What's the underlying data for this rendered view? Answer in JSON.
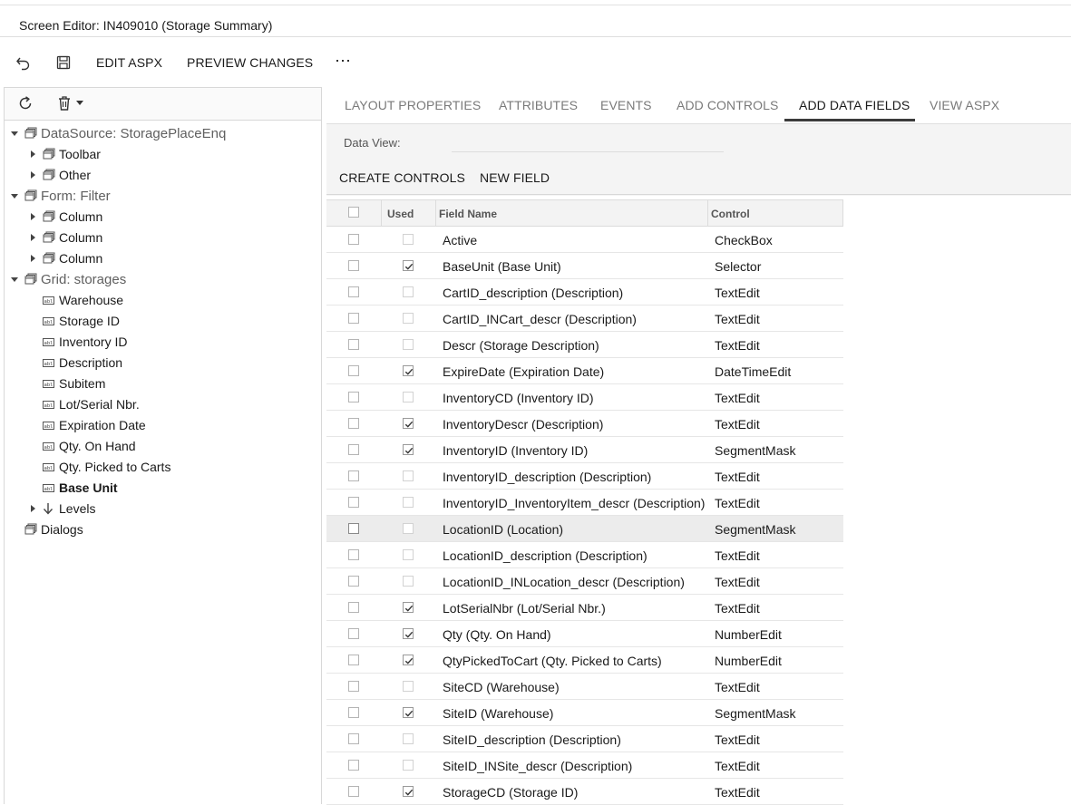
{
  "window": {
    "title": "Screen Editor: IN409010 (Storage Summary)"
  },
  "toolbar": {
    "undo_icon": "undo-icon",
    "save_icon": "save-icon",
    "edit_aspx": "EDIT ASPX",
    "preview_changes": "PREVIEW CHANGES",
    "more": "⋯"
  },
  "tree": {
    "refresh_icon": "refresh-icon",
    "delete_icon": "trash-icon",
    "nodes": [
      {
        "label": "DataSource: StoragePlaceEnq",
        "level": 0,
        "expanded": true
      },
      {
        "label": "Toolbar",
        "level": 1,
        "collapsed": true
      },
      {
        "label": "Other",
        "level": 1,
        "collapsed": true
      },
      {
        "label": "Form: Filter",
        "level": 0,
        "expanded": true
      },
      {
        "label": "Column",
        "level": 1,
        "collapsed": true
      },
      {
        "label": "Column",
        "level": 1,
        "collapsed": true
      },
      {
        "label": "Column",
        "level": 1,
        "collapsed": true
      },
      {
        "label": "Grid: storages",
        "level": 0,
        "expanded": true
      },
      {
        "label": "Warehouse",
        "level": 1,
        "field": true
      },
      {
        "label": "Storage ID",
        "level": 1,
        "field": true
      },
      {
        "label": "Inventory ID",
        "level": 1,
        "field": true
      },
      {
        "label": "Description",
        "level": 1,
        "field": true
      },
      {
        "label": "Subitem",
        "level": 1,
        "field": true
      },
      {
        "label": "Lot/Serial Nbr.",
        "level": 1,
        "field": true
      },
      {
        "label": "Expiration Date",
        "level": 1,
        "field": true
      },
      {
        "label": "Qty. On Hand",
        "level": 1,
        "field": true
      },
      {
        "label": "Qty. Picked to Carts",
        "level": 1,
        "field": true
      },
      {
        "label": "Base Unit",
        "level": 1,
        "field": true,
        "bold": true
      },
      {
        "label": "Levels",
        "level": 1,
        "collapsed": true,
        "arrow": true
      },
      {
        "label": "Dialogs",
        "level": 0
      }
    ]
  },
  "tabs": [
    {
      "label": "LAYOUT PROPERTIES",
      "active": false
    },
    {
      "label": "ATTRIBUTES",
      "active": false
    },
    {
      "label": "EVENTS",
      "active": false
    },
    {
      "label": "ADD CONTROLS",
      "active": false
    },
    {
      "label": "ADD DATA FIELDS",
      "active": true
    },
    {
      "label": "VIEW ASPX",
      "active": false
    }
  ],
  "data_view": {
    "label": "Data View:",
    "value": ""
  },
  "actions": {
    "create_controls": "CREATE CONTROLS",
    "new_field": "NEW FIELD"
  },
  "grid": {
    "headers": {
      "used": "Used",
      "field_name": "Field Name",
      "control": "Control"
    },
    "rows": [
      {
        "used": false,
        "field": "Active",
        "control": "CheckBox"
      },
      {
        "used": true,
        "field": "BaseUnit (Base Unit)",
        "control": "Selector"
      },
      {
        "used": false,
        "field": "CartID_description (Description)",
        "control": "TextEdit"
      },
      {
        "used": false,
        "field": "CartID_INCart_descr (Description)",
        "control": "TextEdit"
      },
      {
        "used": false,
        "field": "Descr (Storage Description)",
        "control": "TextEdit"
      },
      {
        "used": true,
        "field": "ExpireDate (Expiration Date)",
        "control": "DateTimeEdit"
      },
      {
        "used": false,
        "field": "InventoryCD (Inventory ID)",
        "control": "TextEdit"
      },
      {
        "used": true,
        "field": "InventoryDescr (Description)",
        "control": "TextEdit"
      },
      {
        "used": true,
        "field": "InventoryID (Inventory ID)",
        "control": "SegmentMask"
      },
      {
        "used": false,
        "field": "InventoryID_description (Description)",
        "control": "TextEdit"
      },
      {
        "used": false,
        "field": "InventoryID_InventoryItem_descr (Description)",
        "control": "TextEdit"
      },
      {
        "used": false,
        "field": "LocationID (Location)",
        "control": "SegmentMask",
        "highlighted": true
      },
      {
        "used": false,
        "field": "LocationID_description (Description)",
        "control": "TextEdit"
      },
      {
        "used": false,
        "field": "LocationID_INLocation_descr (Description)",
        "control": "TextEdit"
      },
      {
        "used": true,
        "field": "LotSerialNbr (Lot/Serial Nbr.)",
        "control": "TextEdit"
      },
      {
        "used": true,
        "field": "Qty (Qty. On Hand)",
        "control": "NumberEdit"
      },
      {
        "used": true,
        "field": "QtyPickedToCart (Qty. Picked to Carts)",
        "control": "NumberEdit"
      },
      {
        "used": false,
        "field": "SiteCD (Warehouse)",
        "control": "TextEdit"
      },
      {
        "used": true,
        "field": "SiteID (Warehouse)",
        "control": "SegmentMask"
      },
      {
        "used": false,
        "field": "SiteID_description (Description)",
        "control": "TextEdit"
      },
      {
        "used": false,
        "field": "SiteID_INSite_descr (Description)",
        "control": "TextEdit"
      },
      {
        "used": true,
        "field": "StorageCD (Storage ID)",
        "control": "TextEdit"
      }
    ]
  }
}
